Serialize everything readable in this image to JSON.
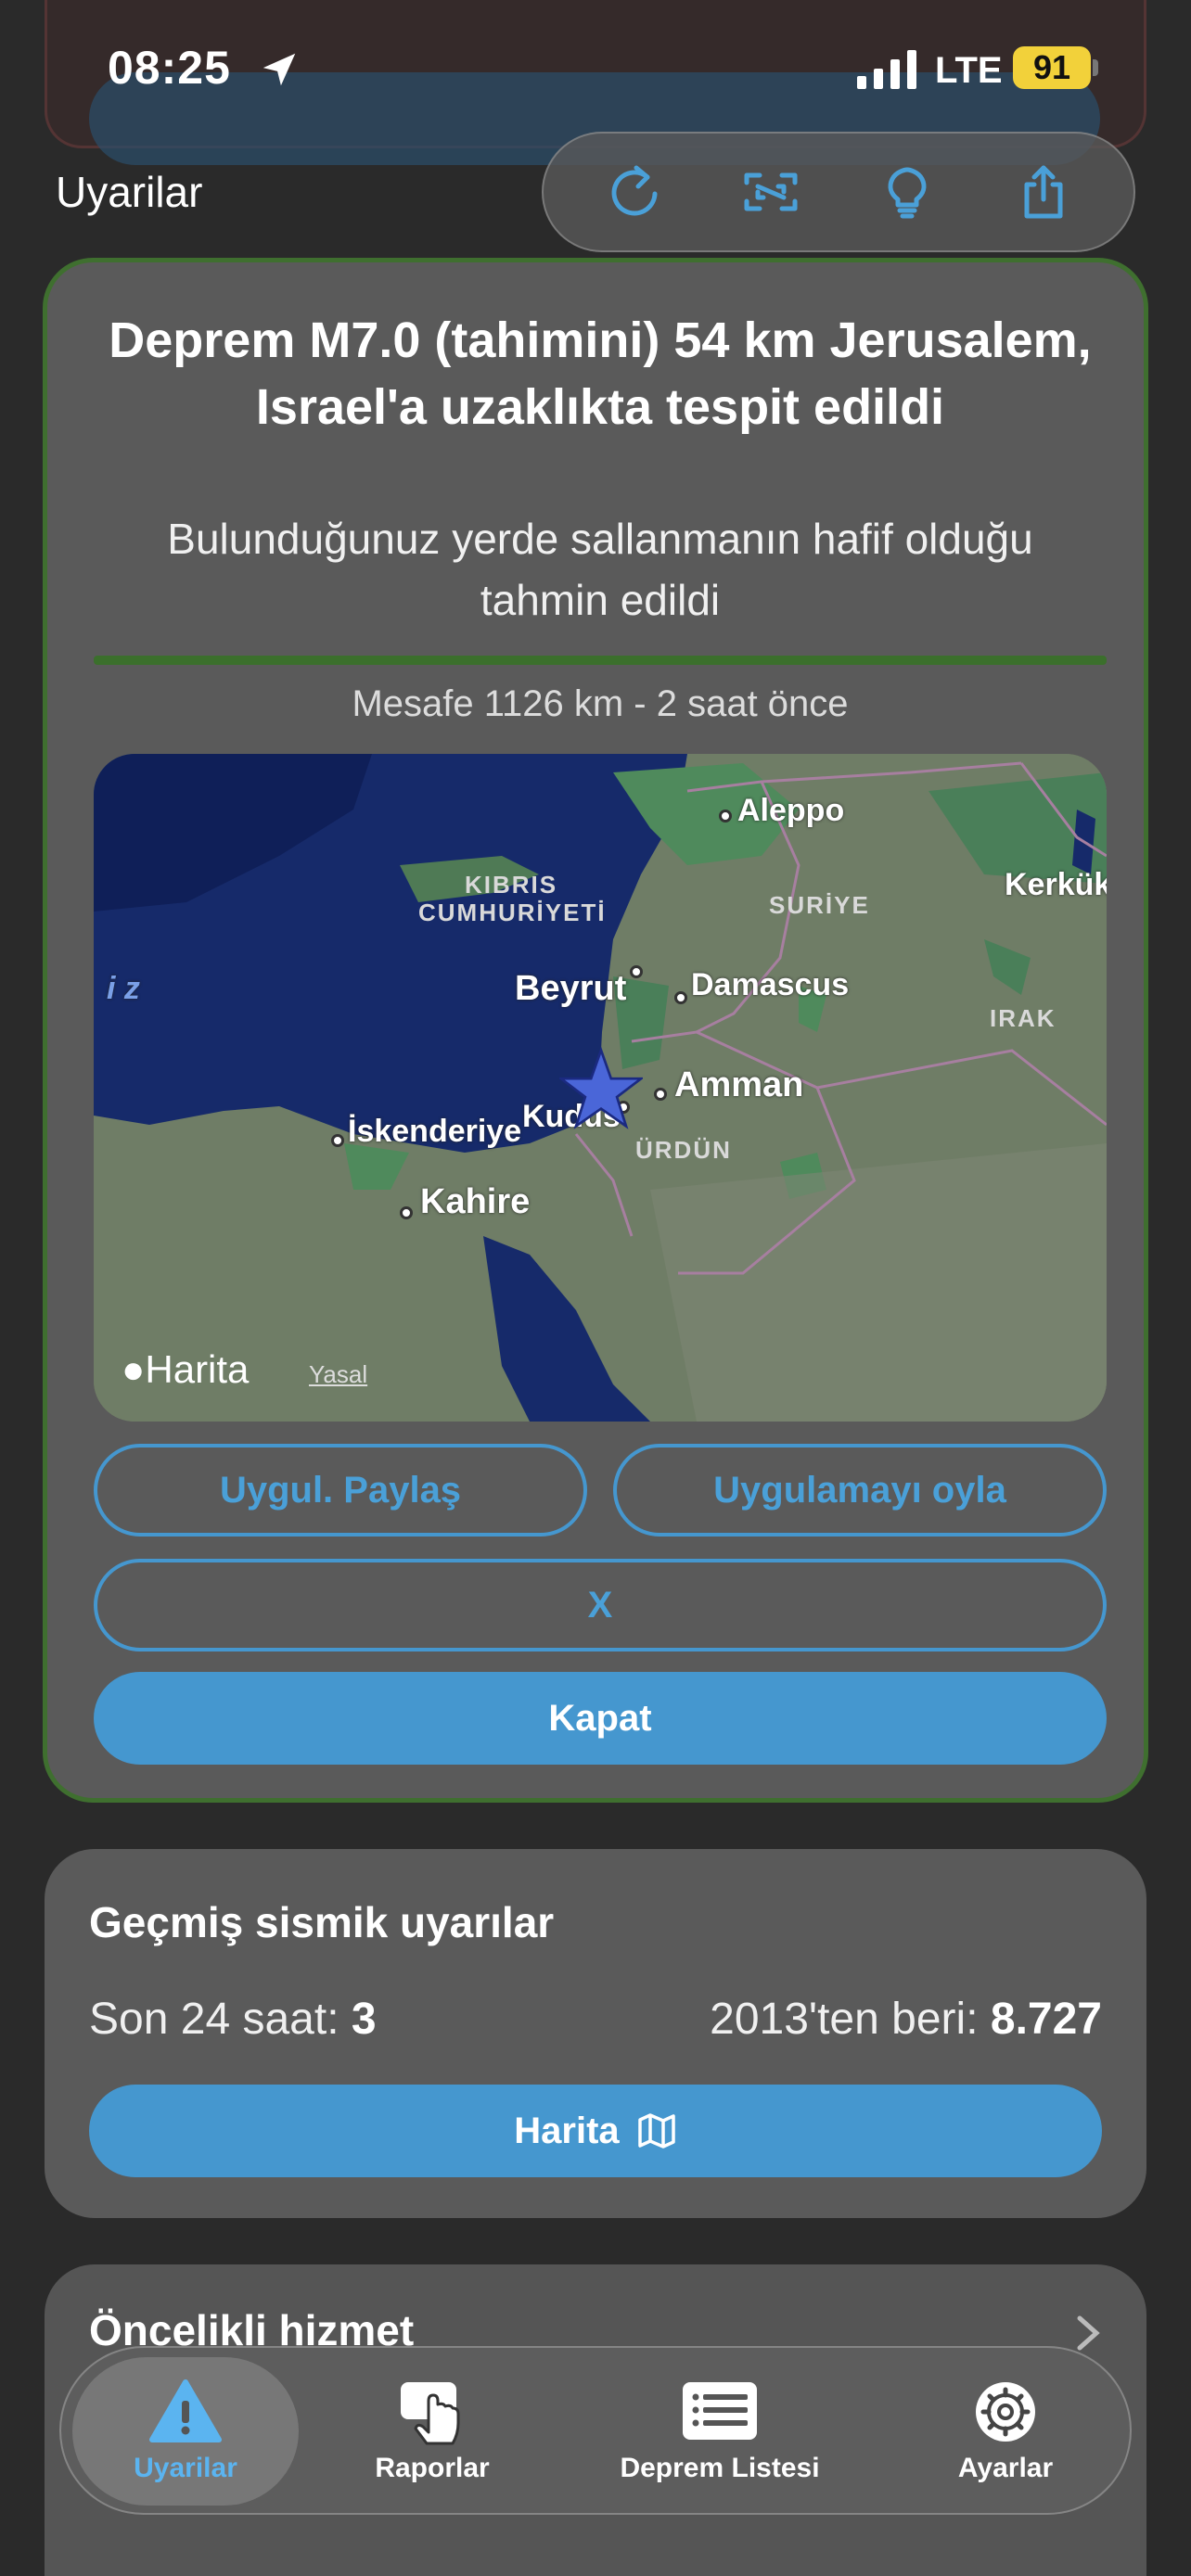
{
  "status_bar": {
    "time": "08:25",
    "network": "LTE",
    "battery": "91"
  },
  "header": {
    "title": "Uyarilar",
    "icons": [
      "refresh-icon",
      "resize-icon",
      "lightbulb-icon",
      "share-icon"
    ]
  },
  "alert": {
    "title": "Deprem M7.0 (tahimini) 54 km Jerusalem, Israel'a uzaklıkta tespit edildi",
    "subtitle": "Bulunduğunuz yerde sallanmanın hafif olduğu tahmin edildi",
    "meta": "Mesafe 1126 km - 2 saat önce",
    "accent_color": "#3b6f2c",
    "map": {
      "labels": {
        "aleppo": "Aleppo",
        "kerkuk": "Kerkük",
        "kibris_1": "KIBRIS",
        "kibris_2": "CUMHURİYETİ",
        "suriye": "SURİYE",
        "beyrut": "Beyrut",
        "damascus": "Damascus",
        "irak": "IRAK",
        "iz": "i z",
        "amman": "Amman",
        "kudus": "Kudüs",
        "iskenderiye": "İskenderiye",
        "urdun": "ÜRDÜN",
        "kahire": "Kahire"
      },
      "brand": "Harita",
      "legal": "Yasal"
    },
    "buttons": {
      "share_app": "Uygul. Paylaş",
      "rate_app": "Uygulamayı oyla",
      "x": "X",
      "close": "Kapat"
    }
  },
  "history": {
    "title": "Geçmiş sismik uyarılar",
    "last24_label": "Son 24 saat:",
    "last24_value": "3",
    "since_label": "2013'ten beri:",
    "since_value": "8.727",
    "map_button": "Harita"
  },
  "priority": {
    "title": "Öncelikli hizmet"
  },
  "tabs": [
    {
      "label": "Uyarilar",
      "icon": "warning-icon",
      "active": true
    },
    {
      "label": "Raporlar",
      "icon": "tap-hand-icon",
      "active": false
    },
    {
      "label": "Deprem Listesi",
      "icon": "list-icon",
      "active": false
    },
    {
      "label": "Ayarlar",
      "icon": "gear-icon",
      "active": false
    }
  ],
  "colors": {
    "accent": "#4597cf",
    "battery": "#f2d13a",
    "active_tab": "#5bb4f0"
  }
}
